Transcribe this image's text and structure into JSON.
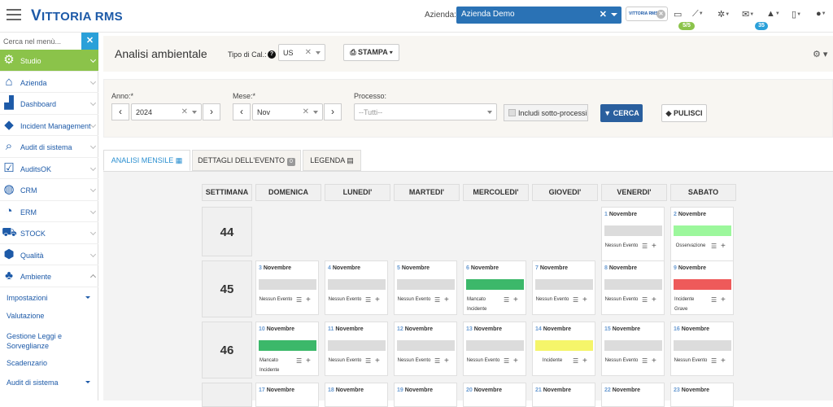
{
  "topbar": {
    "logo": "ITTORIA RMS",
    "logo_v": "V",
    "azienda_label": "Azienda:",
    "azienda_value": "Azienda Demo",
    "mini_logo": "VITTORIA RMS",
    "badge_green": "5/5",
    "badge_blue": "35",
    "colors": {
      "brand": "#1d5aa8",
      "select": "#2a72b5",
      "green_badge": "#8bc34a",
      "blue_badge": "#2aa0d9"
    }
  },
  "sidebar": {
    "search_placeholder": "Cerca nel menù...",
    "items": [
      {
        "label": "Studio",
        "icon": "gear-user-icon",
        "active": true
      },
      {
        "label": "Azienda",
        "icon": "home-icon"
      },
      {
        "label": "Dashboard",
        "icon": "chart-icon"
      },
      {
        "label": "Incident Management",
        "icon": "alert-icon"
      },
      {
        "label": "Audit di sistema",
        "icon": "magnifier-doc-icon"
      },
      {
        "label": "AuditsOK",
        "icon": "checkbox-icon"
      },
      {
        "label": "CRM",
        "icon": "globe-icon"
      },
      {
        "label": "ERM",
        "icon": "dial-icon"
      },
      {
        "label": "STOCK",
        "icon": "truck-icon"
      },
      {
        "label": "Qualità",
        "icon": "shield-icon"
      },
      {
        "label": "Ambiente",
        "icon": "tree-icon",
        "expanded": true
      }
    ],
    "subitems": [
      "Impostazioni",
      "Valutazione",
      "Gestione Leggi e Sorveglianze",
      "Scadenzario",
      "Audit di sistema"
    ]
  },
  "header": {
    "title": "Analisi ambientale",
    "tipo_cal_label": "Tipo di Cal.:",
    "tipo_cal_value": "US",
    "stampa_label": "STAMPA"
  },
  "filters": {
    "anno_label": "Anno:*",
    "anno_value": "2024",
    "mese_label": "Mese:*",
    "mese_value": "Nov",
    "processo_label": "Processo:",
    "processo_value": "--Tutti--",
    "includi_label": "Includi sotto-processi",
    "cerca_label": "CERCA",
    "pulisci_label": "PULISCI"
  },
  "tabs": [
    {
      "label": "ANALISI MENSILE",
      "active": true
    },
    {
      "label": "DETTAGLI DELL'EVENTO",
      "count": "0"
    },
    {
      "label": "LEGENDA"
    }
  ],
  "calendar": {
    "headers": [
      "SETTIMANA",
      "DOMENICA",
      "LUNEDI'",
      "MARTEDI'",
      "MERCOLEDI'",
      "GIOVEDI'",
      "VENERDI'",
      "SABATO"
    ],
    "weeks": [
      "44",
      "45",
      "46",
      ""
    ],
    "month_word": "Novembre",
    "days": [
      {
        "n": "1",
        "status": "Nessun Evento"
      },
      {
        "n": "2",
        "status": "Osservazione",
        "color": "#9cf79c"
      },
      {
        "n": "3",
        "status": "Nessun Evento"
      },
      {
        "n": "4",
        "status": "Nessun Evento"
      },
      {
        "n": "5",
        "status": "Nessun Evento"
      },
      {
        "n": "6",
        "status": "Mancato",
        "status2": "Incidente",
        "color": "#3cb86a"
      },
      {
        "n": "7",
        "status": "Nessun Evento"
      },
      {
        "n": "8",
        "status": "Nessun Evento"
      },
      {
        "n": "9",
        "status": "Incidente",
        "status2": "Grave",
        "color": "#ee5a5a"
      },
      {
        "n": "10",
        "status": "Mancato",
        "status2": "Incidente",
        "color": "#3cb86a"
      },
      {
        "n": "11",
        "status": "Nessun Evento"
      },
      {
        "n": "12",
        "status": "Nessun Evento"
      },
      {
        "n": "13",
        "status": "Nessun Evento"
      },
      {
        "n": "14",
        "status": "Incidente",
        "color": "#f5f56a"
      },
      {
        "n": "15",
        "status": "Nessun Evento"
      },
      {
        "n": "16",
        "status": "Nessun Evento"
      },
      {
        "n": "17"
      },
      {
        "n": "18"
      },
      {
        "n": "19"
      },
      {
        "n": "20"
      },
      {
        "n": "21"
      },
      {
        "n": "22"
      },
      {
        "n": "23"
      }
    ]
  }
}
